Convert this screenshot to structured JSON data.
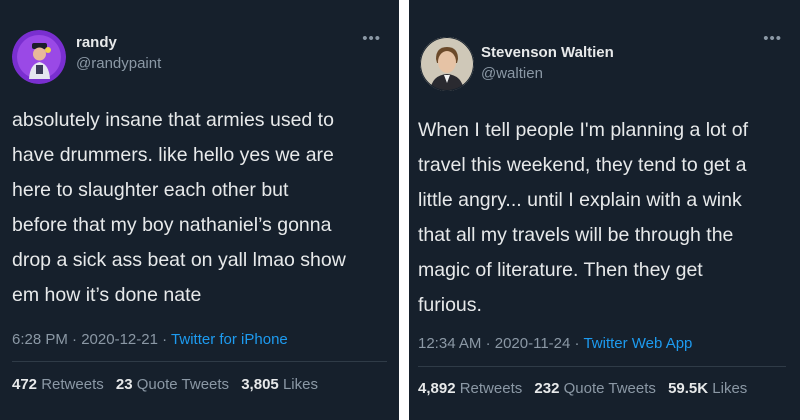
{
  "tweets": [
    {
      "display_name": "randy",
      "handle": "@randypaint",
      "text_lines": [
        "absolutely insane that armies used to",
        "have drummers. like hello yes we are",
        "here to slaughter each other but",
        "before that my boy nathaniel’s gonna",
        "drop a sick ass beat on yall lmao show",
        "em how it’s done nate"
      ],
      "time": "6:28 PM",
      "date": "2020-12-21",
      "separator": "·",
      "source": "Twitter for iPhone",
      "stats": [
        {
          "value": "472",
          "label": "Retweets"
        },
        {
          "value": "23",
          "label": "Quote Tweets"
        },
        {
          "value": "3,805",
          "label": "Likes"
        }
      ],
      "more_icon": "more-horizontal-icon"
    },
    {
      "display_name": "Stevenson Waltien",
      "handle": "@waltien",
      "text_lines": [
        "When I tell people I'm planning a lot of",
        "travel this weekend, they tend to get a",
        "little angry... until I explain with a wink",
        "that all my travels will be through the",
        "magic of literature. Then they get",
        "furious."
      ],
      "time": "12:34 AM",
      "date": "2020-11-24",
      "separator": "·",
      "source": "Twitter Web App",
      "stats": [
        {
          "value": "4,892",
          "label": "Retweets"
        },
        {
          "value": "232",
          "label": "Quote Tweets"
        },
        {
          "value": "59.5K",
          "label": "Likes"
        }
      ],
      "more_icon": "more-horizontal-icon"
    }
  ],
  "colors": {
    "card_bg": "#16202c",
    "text_primary": "#e7e9ea",
    "text_secondary": "#8b98a5",
    "link": "#1d9bf0",
    "divider": "#2f3b47"
  }
}
